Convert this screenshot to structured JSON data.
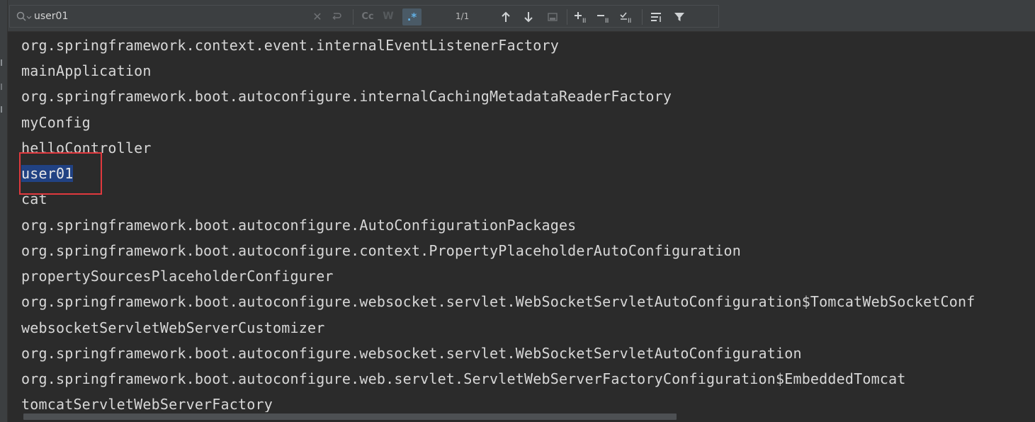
{
  "search": {
    "query": "user01",
    "match_count": "1/1",
    "case_label": "Cc",
    "word_label": "W",
    "regex_label": ".*",
    "regex_active": true
  },
  "console": {
    "lines": [
      "org.springframework.context.event.internalEventListenerFactory",
      "mainApplication",
      "org.springframework.boot.autoconfigure.internalCachingMetadataReaderFactory",
      "myConfig",
      "helloController",
      "user01",
      "cat",
      "org.springframework.boot.autoconfigure.AutoConfigurationPackages",
      "org.springframework.boot.autoconfigure.context.PropertyPlaceholderAutoConfiguration",
      "propertySourcesPlaceholderConfigurer",
      "org.springframework.boot.autoconfigure.websocket.servlet.WebSocketServletAutoConfiguration$TomcatWebSocketConf",
      "websocketServletWebServerCustomizer",
      "org.springframework.boot.autoconfigure.websocket.servlet.WebSocketServletAutoConfiguration",
      "org.springframework.boot.autoconfigure.web.servlet.ServletWebServerFactoryConfiguration$EmbeddedTomcat",
      "tomcatServletWebServerFactory"
    ],
    "highlighted_line": 5
  },
  "icons": [
    "search-icon",
    "clear-icon",
    "replace-icon",
    "match-case-icon",
    "words-icon",
    "regex-icon",
    "arrow-up-icon",
    "arrow-down-icon",
    "select-all-icon",
    "add-occurrence-icon",
    "remove-occurrence-icon",
    "select-all-occurrences-icon",
    "filter-lines-icon",
    "filter-icon"
  ],
  "colors": {
    "background": "#2b2b2b",
    "toolbar": "#3c3f41",
    "text": "#d7d7d7",
    "match_highlight": "#214283",
    "annotation_box": "#e0393e"
  }
}
